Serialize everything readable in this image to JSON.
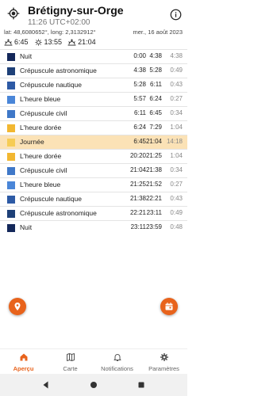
{
  "header": {
    "title": "Brétigny-sur-Orge",
    "time": "11:26 UTC+02:00",
    "coords": "lat: 48,6080652°, long: 2,3132912°",
    "date": "mer., 16 août 2023",
    "sunrise": "6:45",
    "noon": "13:55",
    "sunset": "21:04"
  },
  "rows": [
    {
      "name": "Nuit",
      "start": "0:00",
      "end": "4:38",
      "dur": "4:38",
      "color": "#14285a"
    },
    {
      "name": "Crépuscule astronomique",
      "start": "4:38",
      "end": "5:28",
      "dur": "0:49",
      "color": "#1e4078"
    },
    {
      "name": "Crépuscule nautique",
      "start": "5:28",
      "end": "6:11",
      "dur": "0:43",
      "color": "#2d5aa5"
    },
    {
      "name": "L'heure bleue",
      "start": "5:57",
      "end": "6:24",
      "dur": "0:27",
      "color": "#4a86d8"
    },
    {
      "name": "Crépuscule civil",
      "start": "6:11",
      "end": "6:45",
      "dur": "0:34",
      "color": "#3f78c8"
    },
    {
      "name": "L'heure dorée",
      "start": "6:24",
      "end": "7:29",
      "dur": "1:04",
      "color": "#f2b731"
    },
    {
      "name": "Journée",
      "start": "6:45",
      "end": "21:04",
      "dur": "14:18",
      "color": "#f6cc55"
    },
    {
      "name": "L'heure dorée",
      "start": "20:20",
      "end": "21:25",
      "dur": "1:04",
      "color": "#f2b731"
    },
    {
      "name": "Crépuscule civil",
      "start": "21:04",
      "end": "21:38",
      "dur": "0:34",
      "color": "#3f78c8"
    },
    {
      "name": "L'heure bleue",
      "start": "21:25",
      "end": "21:52",
      "dur": "0:27",
      "color": "#4a86d8"
    },
    {
      "name": "Crépuscule nautique",
      "start": "21:38",
      "end": "22:21",
      "dur": "0:43",
      "color": "#2d5aa5"
    },
    {
      "name": "Crépuscule astronomique",
      "start": "22:21",
      "end": "23:11",
      "dur": "0:49",
      "color": "#1e4078"
    },
    {
      "name": "Nuit",
      "start": "23:11",
      "end": "23:59",
      "dur": "0:48",
      "color": "#14285a"
    }
  ],
  "active_row": 6,
  "fabs": {
    "left_icon": "location-pin-icon",
    "right_icon": "calendar-icon"
  },
  "nav": [
    {
      "label": "Aperçu",
      "icon": "home-icon",
      "active": true
    },
    {
      "label": "Carte",
      "icon": "map-icon",
      "active": false
    },
    {
      "label": "Notifications",
      "icon": "bell-icon",
      "active": false
    },
    {
      "label": "Paramètres",
      "icon": "gear-icon",
      "active": false
    }
  ],
  "accent": "#e8631c",
  "active_row_bg": "#fbe2b6"
}
